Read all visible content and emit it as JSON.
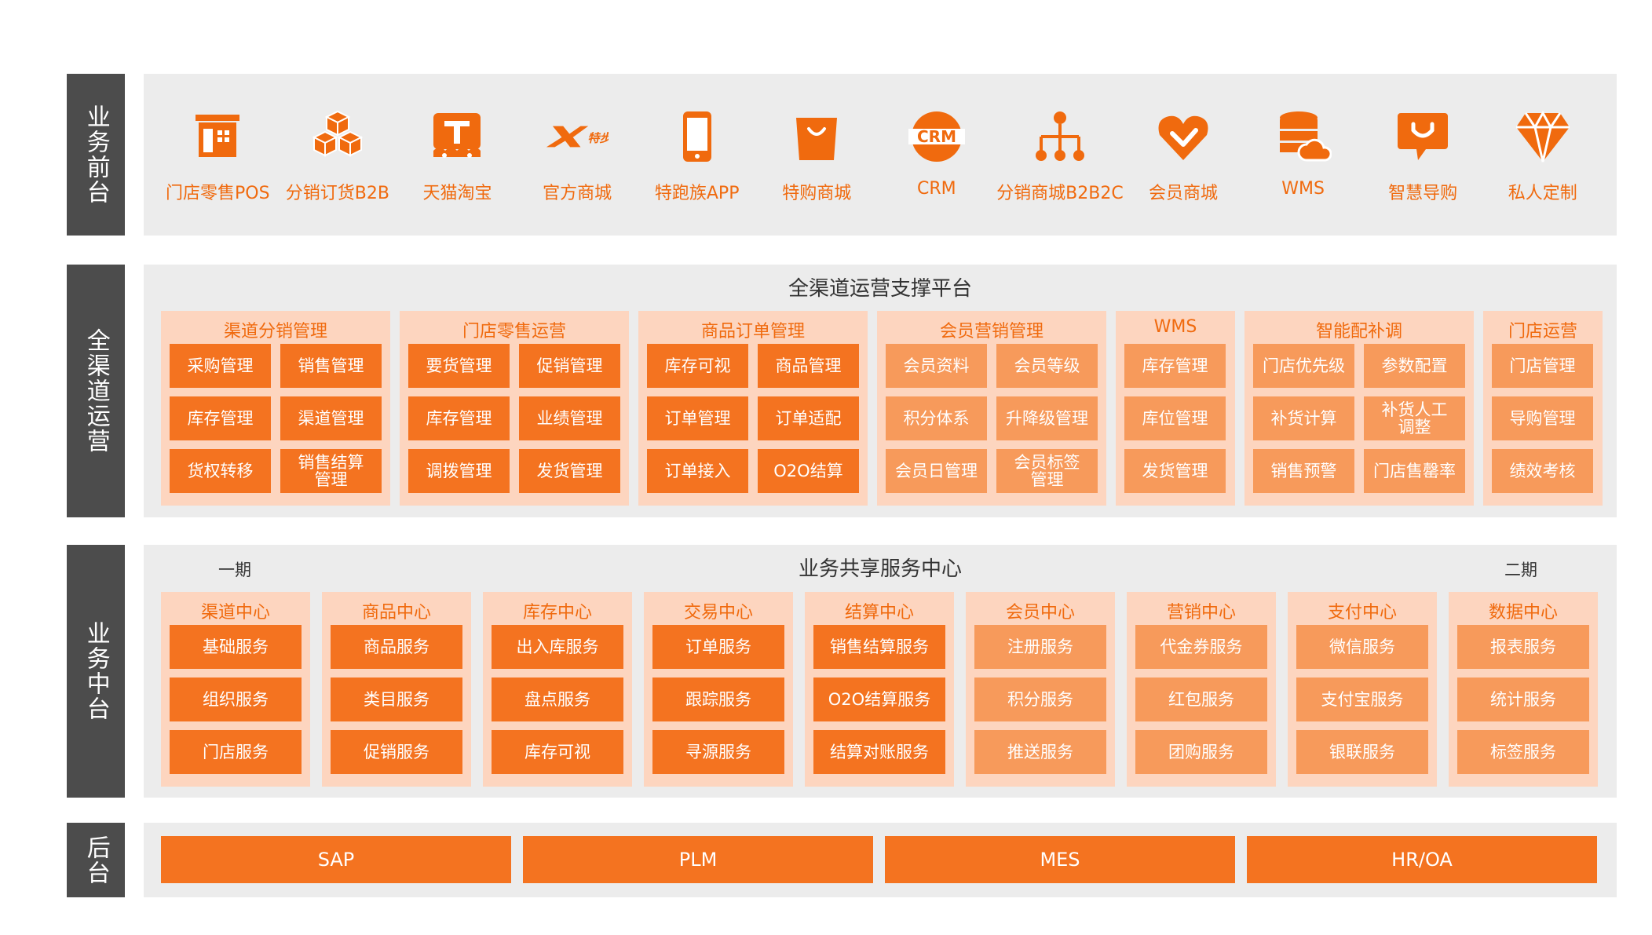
{
  "side_labels": {
    "front": "业务前台",
    "channel": "全渠道运营",
    "middle": "业务中台",
    "back": "后台"
  },
  "front": {
    "items": [
      {
        "label": "门店零售POS",
        "icon": "store-icon"
      },
      {
        "label": "分销订货B2B",
        "icon": "cubes-icon"
      },
      {
        "label": "天猫淘宝",
        "icon": "tmall-icon"
      },
      {
        "label": "官方商城",
        "icon": "xtep-logo-icon"
      },
      {
        "label": "特跑族APP",
        "icon": "phone-icon"
      },
      {
        "label": "特购商城",
        "icon": "shopping-bag-icon"
      },
      {
        "label": "CRM",
        "icon": "crm-icon"
      },
      {
        "label": "分销商城B2B2C",
        "icon": "network-icon"
      },
      {
        "label": "会员商城",
        "icon": "heart-check-icon"
      },
      {
        "label": "WMS",
        "icon": "database-cloud-icon"
      },
      {
        "label": "智慧导购",
        "icon": "chat-bubble-icon"
      },
      {
        "label": "私人定制",
        "icon": "diamond-icon"
      }
    ],
    "accent": "#f06a0e"
  },
  "channel": {
    "title": "全渠道运营支撑平台",
    "groups": [
      {
        "title": "渠道分销管理",
        "style": "dark",
        "items": [
          "采购管理",
          "销售管理",
          "库存管理",
          "渠道管理",
          "货权转移",
          "销售结算\n管理"
        ]
      },
      {
        "title": "门店零售运营",
        "style": "dark",
        "items": [
          "要货管理",
          "促销管理",
          "库存管理",
          "业绩管理",
          "调拨管理",
          "发货管理"
        ]
      },
      {
        "title": "商品订单管理",
        "style": "dark",
        "items": [
          "库存可视",
          "商品管理",
          "订单管理",
          "订单适配",
          "订单接入",
          "O2O结算"
        ]
      },
      {
        "title": "会员营销管理",
        "style": "light",
        "items": [
          "会员资料",
          "会员等级",
          "积分体系",
          "升降级管理",
          "会员日管理",
          "会员标签\n管理"
        ]
      },
      {
        "title": "WMS",
        "style": "light",
        "items": [
          "库存管理",
          "库位管理",
          "发货管理"
        ]
      },
      {
        "title": "智能配补调",
        "style": "light",
        "items": [
          "门店优先级",
          "参数配置",
          "补货计算",
          "补货人工\n调整",
          "销售预警",
          "门店售罄率"
        ]
      },
      {
        "title": "门店运营",
        "style": "light",
        "items": [
          "门店管理",
          "导购管理",
          "绩效考核"
        ]
      }
    ]
  },
  "middle": {
    "title": "业务共享服务中心",
    "phase1": "一期",
    "phase2": "二期",
    "groups": [
      {
        "title": "渠道中心",
        "style": "dark",
        "items": [
          "基础服务",
          "组织服务",
          "门店服务"
        ]
      },
      {
        "title": "商品中心",
        "style": "dark",
        "items": [
          "商品服务",
          "类目服务",
          "促销服务"
        ]
      },
      {
        "title": "库存中心",
        "style": "dark",
        "items": [
          "出入库服务",
          "盘点服务",
          "库存可视"
        ]
      },
      {
        "title": "交易中心",
        "style": "dark",
        "items": [
          "订单服务",
          "跟踪服务",
          "寻源服务"
        ]
      },
      {
        "title": "结算中心",
        "style": "dark",
        "items": [
          "销售结算服务",
          "O2O结算服务",
          "结算对账服务"
        ]
      },
      {
        "title": "会员中心",
        "style": "light",
        "items": [
          "注册服务",
          "积分服务",
          "推送服务"
        ]
      },
      {
        "title": "营销中心",
        "style": "light",
        "items": [
          "代金券服务",
          "红包服务",
          "团购服务"
        ]
      },
      {
        "title": "支付中心",
        "style": "light",
        "items": [
          "微信服务",
          "支付宝服务",
          "银联服务"
        ]
      },
      {
        "title": "数据中心",
        "style": "light",
        "items": [
          "报表服务",
          "统计服务",
          "标签服务"
        ]
      }
    ]
  },
  "back": {
    "items": [
      "SAP",
      "PLM",
      "MES",
      "HR/OA"
    ]
  },
  "colors": {
    "accent": "#f47320",
    "accent_light": "#f79a5b",
    "group_bg": "#fdd5bf",
    "panel_bg": "#ececec",
    "side_bg": "#4c4c4c"
  }
}
